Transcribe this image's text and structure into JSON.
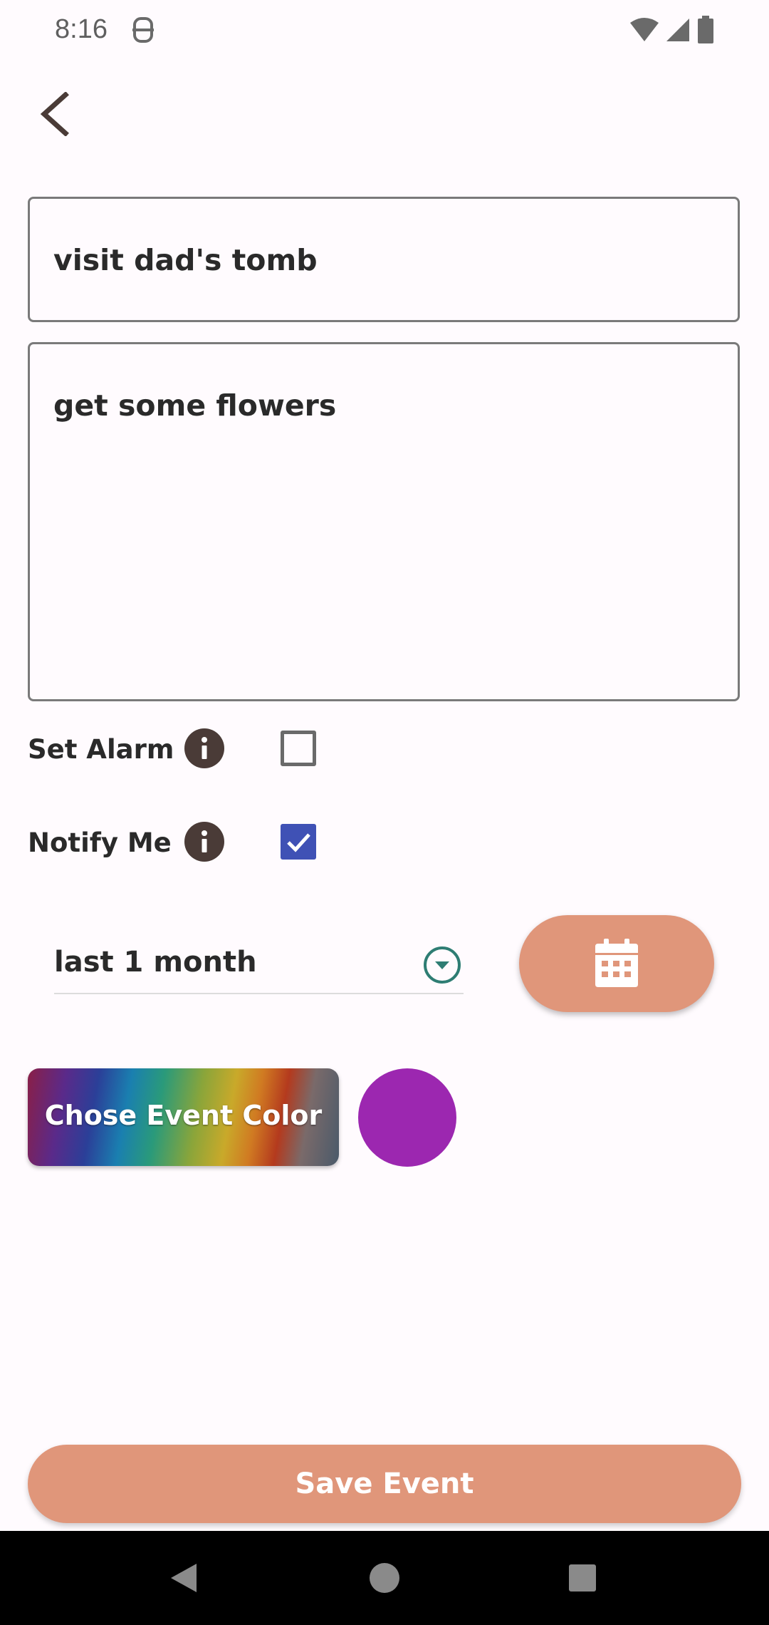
{
  "status_bar": {
    "time": "8:16"
  },
  "form": {
    "title_value": "visit dad's tomb",
    "description_value": "get some flowers"
  },
  "options": {
    "set_alarm": {
      "label": "Set Alarm",
      "checked": false
    },
    "notify_me": {
      "label": "Notify Me",
      "checked": true
    }
  },
  "notify_interval": {
    "selected": "last 1 month"
  },
  "color": {
    "button_label": "Chose Event Color",
    "selected_color": "#9c27b0"
  },
  "save_button_label": "Save Event",
  "theme": {
    "accent": "#e0967a",
    "checkbox": "#3f51b5",
    "dropdown_icon": "#2e7d73",
    "info_icon": "#4a3b37",
    "background": "#fffbfe"
  },
  "icons": {
    "back": "arrow-back-icon",
    "info": "info-icon",
    "dropdown": "chevron-down-circle-icon",
    "calendar": "calendar-icon",
    "nav_back": "nav-back-icon",
    "nav_home": "nav-home-icon",
    "nav_recents": "nav-recents-icon"
  }
}
